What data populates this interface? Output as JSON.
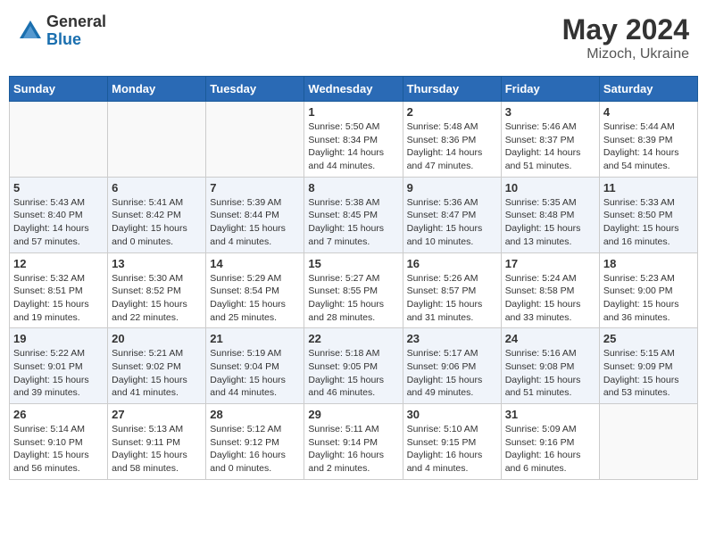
{
  "header": {
    "logo_general": "General",
    "logo_blue": "Blue",
    "title": "May 2024",
    "location": "Mizoch, Ukraine"
  },
  "weekdays": [
    "Sunday",
    "Monday",
    "Tuesday",
    "Wednesday",
    "Thursday",
    "Friday",
    "Saturday"
  ],
  "weeks": [
    [
      {
        "day": "",
        "info": ""
      },
      {
        "day": "",
        "info": ""
      },
      {
        "day": "",
        "info": ""
      },
      {
        "day": "1",
        "info": "Sunrise: 5:50 AM\nSunset: 8:34 PM\nDaylight: 14 hours\nand 44 minutes."
      },
      {
        "day": "2",
        "info": "Sunrise: 5:48 AM\nSunset: 8:36 PM\nDaylight: 14 hours\nand 47 minutes."
      },
      {
        "day": "3",
        "info": "Sunrise: 5:46 AM\nSunset: 8:37 PM\nDaylight: 14 hours\nand 51 minutes."
      },
      {
        "day": "4",
        "info": "Sunrise: 5:44 AM\nSunset: 8:39 PM\nDaylight: 14 hours\nand 54 minutes."
      }
    ],
    [
      {
        "day": "5",
        "info": "Sunrise: 5:43 AM\nSunset: 8:40 PM\nDaylight: 14 hours\nand 57 minutes."
      },
      {
        "day": "6",
        "info": "Sunrise: 5:41 AM\nSunset: 8:42 PM\nDaylight: 15 hours\nand 0 minutes."
      },
      {
        "day": "7",
        "info": "Sunrise: 5:39 AM\nSunset: 8:44 PM\nDaylight: 15 hours\nand 4 minutes."
      },
      {
        "day": "8",
        "info": "Sunrise: 5:38 AM\nSunset: 8:45 PM\nDaylight: 15 hours\nand 7 minutes."
      },
      {
        "day": "9",
        "info": "Sunrise: 5:36 AM\nSunset: 8:47 PM\nDaylight: 15 hours\nand 10 minutes."
      },
      {
        "day": "10",
        "info": "Sunrise: 5:35 AM\nSunset: 8:48 PM\nDaylight: 15 hours\nand 13 minutes."
      },
      {
        "day": "11",
        "info": "Sunrise: 5:33 AM\nSunset: 8:50 PM\nDaylight: 15 hours\nand 16 minutes."
      }
    ],
    [
      {
        "day": "12",
        "info": "Sunrise: 5:32 AM\nSunset: 8:51 PM\nDaylight: 15 hours\nand 19 minutes."
      },
      {
        "day": "13",
        "info": "Sunrise: 5:30 AM\nSunset: 8:52 PM\nDaylight: 15 hours\nand 22 minutes."
      },
      {
        "day": "14",
        "info": "Sunrise: 5:29 AM\nSunset: 8:54 PM\nDaylight: 15 hours\nand 25 minutes."
      },
      {
        "day": "15",
        "info": "Sunrise: 5:27 AM\nSunset: 8:55 PM\nDaylight: 15 hours\nand 28 minutes."
      },
      {
        "day": "16",
        "info": "Sunrise: 5:26 AM\nSunset: 8:57 PM\nDaylight: 15 hours\nand 31 minutes."
      },
      {
        "day": "17",
        "info": "Sunrise: 5:24 AM\nSunset: 8:58 PM\nDaylight: 15 hours\nand 33 minutes."
      },
      {
        "day": "18",
        "info": "Sunrise: 5:23 AM\nSunset: 9:00 PM\nDaylight: 15 hours\nand 36 minutes."
      }
    ],
    [
      {
        "day": "19",
        "info": "Sunrise: 5:22 AM\nSunset: 9:01 PM\nDaylight: 15 hours\nand 39 minutes."
      },
      {
        "day": "20",
        "info": "Sunrise: 5:21 AM\nSunset: 9:02 PM\nDaylight: 15 hours\nand 41 minutes."
      },
      {
        "day": "21",
        "info": "Sunrise: 5:19 AM\nSunset: 9:04 PM\nDaylight: 15 hours\nand 44 minutes."
      },
      {
        "day": "22",
        "info": "Sunrise: 5:18 AM\nSunset: 9:05 PM\nDaylight: 15 hours\nand 46 minutes."
      },
      {
        "day": "23",
        "info": "Sunrise: 5:17 AM\nSunset: 9:06 PM\nDaylight: 15 hours\nand 49 minutes."
      },
      {
        "day": "24",
        "info": "Sunrise: 5:16 AM\nSunset: 9:08 PM\nDaylight: 15 hours\nand 51 minutes."
      },
      {
        "day": "25",
        "info": "Sunrise: 5:15 AM\nSunset: 9:09 PM\nDaylight: 15 hours\nand 53 minutes."
      }
    ],
    [
      {
        "day": "26",
        "info": "Sunrise: 5:14 AM\nSunset: 9:10 PM\nDaylight: 15 hours\nand 56 minutes."
      },
      {
        "day": "27",
        "info": "Sunrise: 5:13 AM\nSunset: 9:11 PM\nDaylight: 15 hours\nand 58 minutes."
      },
      {
        "day": "28",
        "info": "Sunrise: 5:12 AM\nSunset: 9:12 PM\nDaylight: 16 hours\nand 0 minutes."
      },
      {
        "day": "29",
        "info": "Sunrise: 5:11 AM\nSunset: 9:14 PM\nDaylight: 16 hours\nand 2 minutes."
      },
      {
        "day": "30",
        "info": "Sunrise: 5:10 AM\nSunset: 9:15 PM\nDaylight: 16 hours\nand 4 minutes."
      },
      {
        "day": "31",
        "info": "Sunrise: 5:09 AM\nSunset: 9:16 PM\nDaylight: 16 hours\nand 6 minutes."
      },
      {
        "day": "",
        "info": ""
      }
    ]
  ]
}
